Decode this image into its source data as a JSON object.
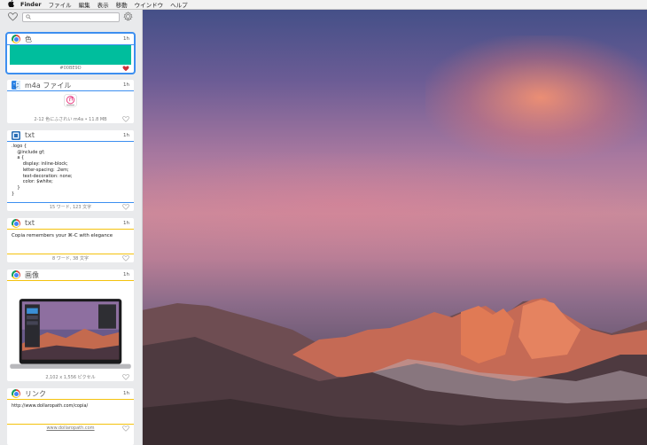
{
  "menubar": {
    "apple": "",
    "app": "Finder",
    "items": [
      "ファイル",
      "編集",
      "表示",
      "移動",
      "ウインドウ",
      "ヘルプ"
    ]
  },
  "colors": {
    "selection": "#3d8ff0",
    "color_swatch": "#00BE9D",
    "blue_line": "#3d8ff0",
    "yellow_line": "#f4c20d",
    "heart_active": "#d0303a"
  },
  "cards": [
    {
      "icon": "chrome-icon",
      "title": "色",
      "time": "1h",
      "footer": "#00BE9D",
      "favorited": true
    },
    {
      "icon": "finder-icon",
      "title": "m4a ファイル",
      "time": "1h",
      "footer": "2-12 色にふされい m4a • 11.8 MB",
      "favorited": false
    },
    {
      "icon": "code-editor-icon",
      "title": "txt",
      "time": "1h",
      "lines": [
        ".logo {",
        "    @include gf;",
        "    a {",
        "        display: inline-block;",
        "        letter-spacing: .2em;",
        "        text-decoration: none;",
        "        color: $white;",
        "    }",
        "}"
      ],
      "footer": "15 ワード, 123 文字",
      "favorited": false
    },
    {
      "icon": "chrome-icon",
      "title": "txt",
      "time": "1h",
      "text": "Copia remembers your ⌘-C with elegance",
      "footer": "8 ワード, 38 文字",
      "favorited": false
    },
    {
      "icon": "chrome-icon",
      "title": "画像",
      "time": "1h",
      "footer": "2,102 x 1,556 ピクセル",
      "favorited": false
    },
    {
      "icon": "chrome-icon",
      "title": "リンク",
      "time": "1h",
      "text": "http://www.dollaropath.com/copia/",
      "footer": "www.dollaropath.com",
      "favorited": false
    }
  ]
}
